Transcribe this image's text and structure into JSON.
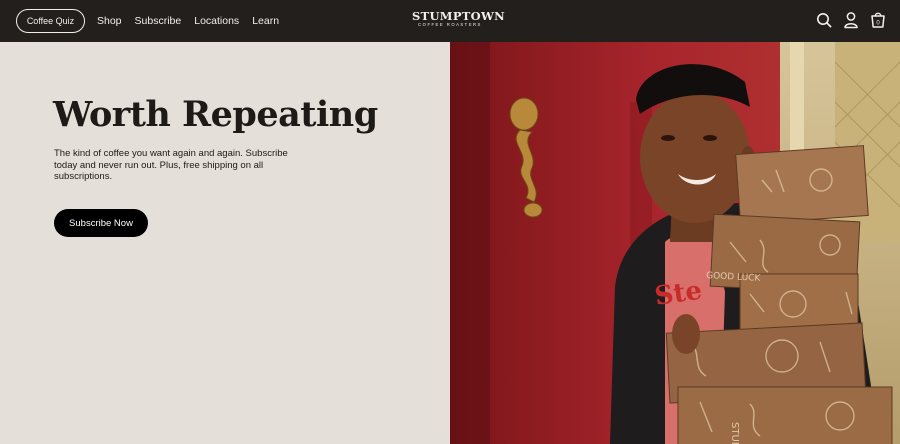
{
  "header": {
    "quiz_label": "Coffee Quiz",
    "nav": [
      "Shop",
      "Subscribe",
      "Locations",
      "Learn"
    ],
    "logo_main": "STUMPTOWN",
    "logo_sub": "COFFEE ROASTERS",
    "icons": [
      "search-icon",
      "account-icon",
      "cart-icon"
    ],
    "cart_count": "0"
  },
  "hero": {
    "title": "Worth Repeating",
    "subtitle": "The kind of coffee you want again and again. Subscribe today and never run out. Plus, free shipping on all subscriptions.",
    "cta": "Subscribe Now"
  },
  "colors": {
    "header_bg": "#221f1c",
    "hero_bg": "#e4dfd8",
    "cta_bg": "#000000",
    "wall_red": "#a8252c",
    "box_brown": "#9a6a45"
  }
}
